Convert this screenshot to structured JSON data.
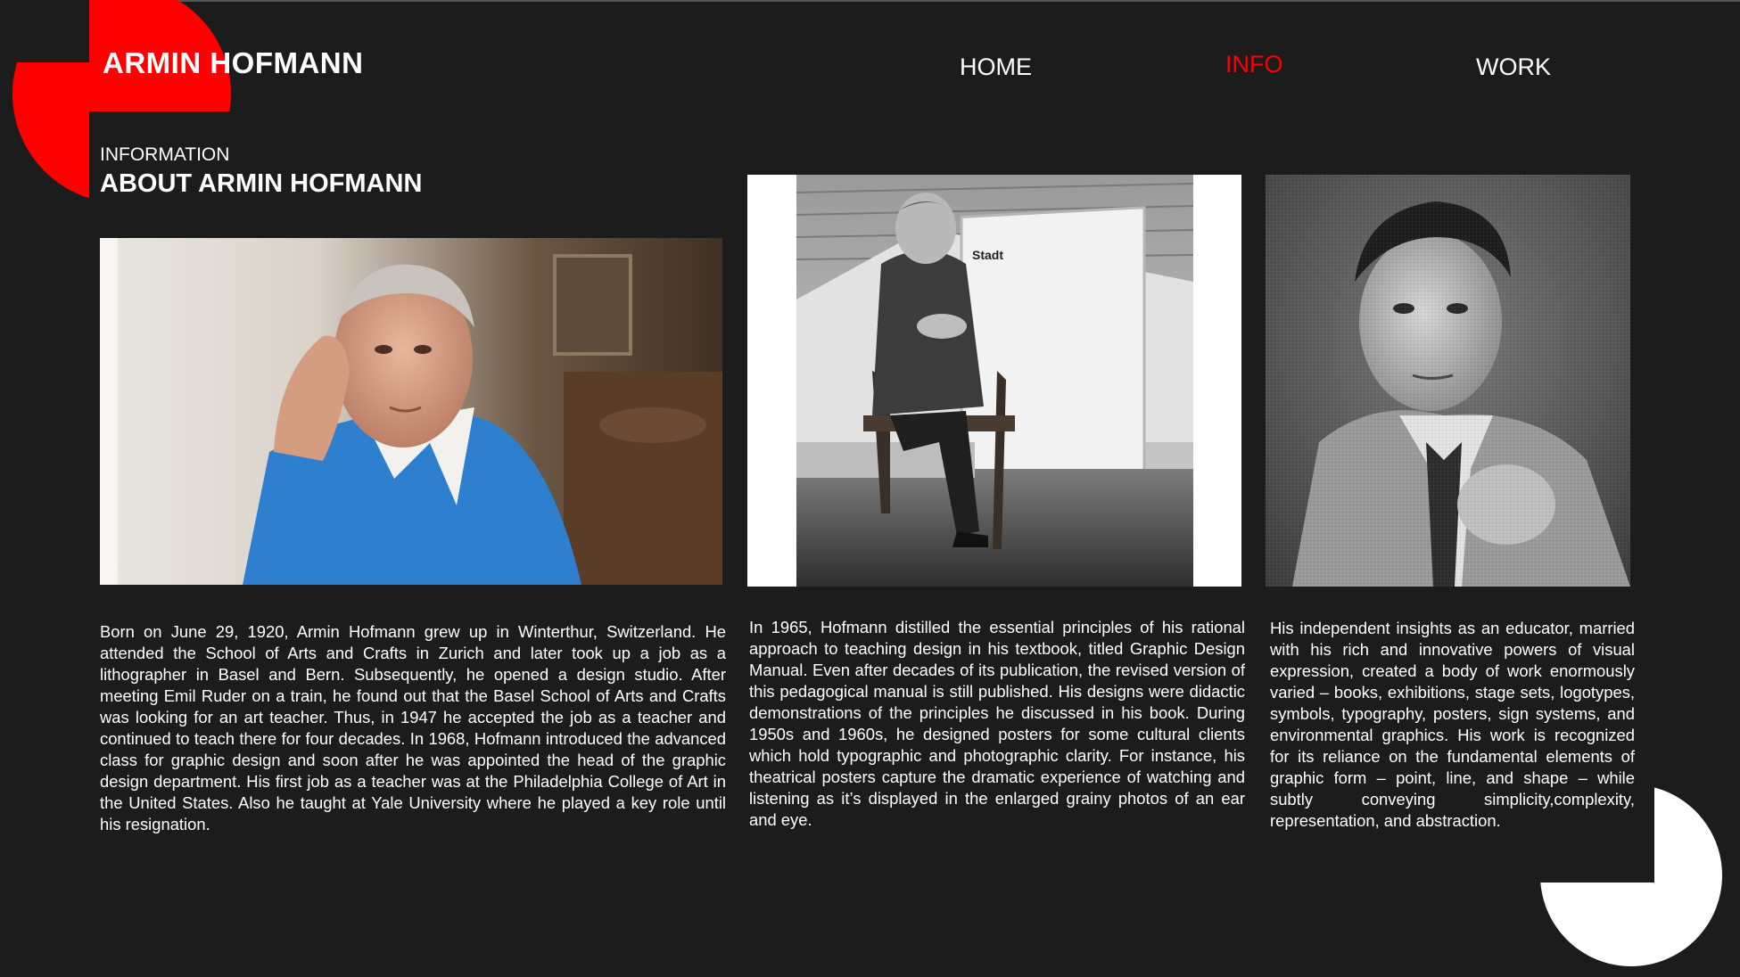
{
  "header": {
    "brand": "ARMIN HOFMANN",
    "nav": [
      "HOME",
      "INFO",
      "WORK"
    ],
    "active_nav": "INFO"
  },
  "section": {
    "eyebrow": "INFORMATION",
    "title": "ABOUT ARMIN HOFMANN"
  },
  "columns": [
    {
      "photo": "portrait-blue-sweater",
      "text": "Born on June 29, 1920, Armin Hofmann grew up in Winterthur, Switzerland. He attended the School of Arts and Crafts in Zurich and later took up a job as a lithographer in Basel and Bern. Subsequently, he opened a design studio. After meeting Emil Ruder on a train, he found out that the Basel School of Arts and Crafts was looking for an art teacher. Thus, in 1947 he accepted the job as a teacher and continued to teach there for four decades. In 1968, Hofmann intro­duced the advanced class for graphic design and soon after he was appointed the head of the graphic design department. His first job as a teacher was at the Philadelphia College of Art in the United States. Also he taught at Yale University where he played a key role until his resignation."
    },
    {
      "photo": "black-white-seated-portrait",
      "text": "In 1965, Hofmann distilled the essential principles of his rational approach to teaching design in his textbook, titled Graphic Design Manual. Even after decades of its publication, the re­vised version of this pedagogical manual is still published. His designs were didactic demonstrations of the principles he dis­cussed in his book. During 1950s and 1960s, he designed post­ers for some cultural clients which hold typographic and photo­graphic clarity. For instance, his theatrical posters capture the dramatic experience of watching and listening as it’s displayed in the enlarged grainy photos of an ear and eye."
    },
    {
      "photo": "vintage-grainy-portrait",
      "text": "His independent insights as an educator, mar­ried with his rich and innovative powers of visual expression, created a body of work enormously varied – books, exhibitions, stage sets, logotypes, symbols, typography, posters, sign systems, and environmental graphics. His work is recognized for its reliance on the fun­damental elements of graphic form – point, line, and shape – while subtly conveying sim­plicity,complexity, representation, and abstrac­tion."
    }
  ],
  "colors": {
    "background": "#1c1c1c",
    "accent": "#ff0000",
    "text": "#ffffff"
  }
}
